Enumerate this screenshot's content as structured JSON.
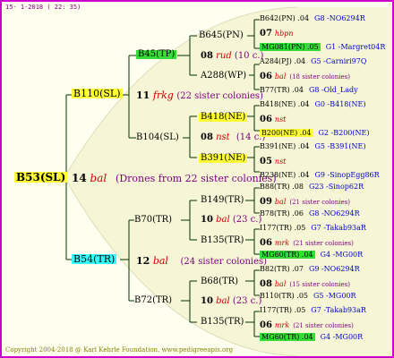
{
  "header": {
    "date": "15-  1-2018 ( 22: 35)"
  },
  "footer": {
    "text": "Copyright 2004-2018 @ Karl Kehrle Foundation.   www.pedigreeapis.org"
  },
  "queen": {
    "label": "B53(SL)"
  },
  "drones": {
    "num": "14",
    "code": "bal",
    "text": "(Drones from 22 sister colonies)"
  },
  "gen2": {
    "top": {
      "label": "B110(SL)",
      "num": "11",
      "code": "frkg",
      "text": "(22 sister colonies)"
    },
    "bottom": {
      "label": "B54(TR)",
      "num": "12",
      "code": "bal",
      "text": "(24 sister colonies)"
    }
  },
  "gen3": {
    "a": {
      "label": "B45(TP)"
    },
    "b": {
      "label": "B104(SL)",
      "num": "08",
      "code": "nst",
      "text": "(14 c.)"
    },
    "c": {
      "label": "B70(TR)",
      "num": "10",
      "code": "bal",
      "text": "(23 c.)"
    },
    "d": {
      "label": "B72(TR)",
      "num": "10",
      "code": "bal",
      "text": "(23 c.)"
    }
  },
  "gen4": {
    "a1": {
      "label": "B645(PN)",
      "num": "08",
      "code": "rud",
      "text": "(10 c.)"
    },
    "a2": {
      "label": "A288(WP)"
    },
    "b1": {
      "label": "B418(NE)"
    },
    "b2": {
      "label": "B391(NE)"
    },
    "c1": {
      "label": "B149(TR)",
      "num": "10",
      "code": "bal",
      "text": "(23 c.)"
    },
    "c2": {
      "label": "B135(TR)"
    },
    "d1": {
      "label": "B68(TR)"
    },
    "d2": {
      "label": "B135(TR)"
    }
  },
  "gen5": [
    {
      "label": "B642(PN) .04",
      "ref": "G8 -NO6294R"
    },
    {
      "num": "07",
      "code": "hbpn",
      "text": ""
    },
    {
      "label": "MG081(PN) .05",
      "ref": "G1 -Margret04R"
    },
    {
      "label": "A284(PJ) .04",
      "ref": "G5 -Carniri97Q"
    },
    {
      "num": "06",
      "code": "bal",
      "text": "(18 sister colonies)"
    },
    {
      "label": "B77(TR) .04",
      "ref": "G8 -Old_Lady"
    },
    {
      "label": "B418(NE) .04",
      "ref": "G0 -B418(NE)"
    },
    {
      "num": "06",
      "code": "nst",
      "text": ""
    },
    {
      "label": "B200(NE) .04",
      "ref": "G2 -B200(NE)"
    },
    {
      "label": "B391(NE) .04",
      "ref": "G5 -B391(NE)"
    },
    {
      "num": "05",
      "code": "nst",
      "text": ""
    },
    {
      "label": "B238(NE) .04",
      "ref": "G9 -SinopEgg86R"
    },
    {
      "label": "B88(TR) .08",
      "ref": "G23 -Sinop62R"
    },
    {
      "num": "09",
      "code": "bal",
      "text": "(21 sister colonies)"
    },
    {
      "label": "B78(TR) .06",
      "ref": "G8 -NO6294R"
    },
    {
      "label": "I177(TR) .05",
      "ref": "G7 -Takab93aR"
    },
    {
      "num": "06",
      "code": "mrk",
      "text": "(21 sister colonies)"
    },
    {
      "label": "MG60(TR) .04",
      "ref": "G4 -MG00R"
    },
    {
      "label": "B82(TR) .07",
      "ref": "G9 -NO6294R"
    },
    {
      "num": "08",
      "code": "bal",
      "text": "(15 sister colonies)"
    },
    {
      "label": "B110(TR) .05",
      "ref": "G5 -MG00R"
    },
    {
      "label": "I177(TR) .05",
      "ref": "G7 -Takab93aR"
    },
    {
      "num": "06",
      "code": "mrk",
      "text": "(21 sister colonies)"
    },
    {
      "label": "MG60(TR) .04",
      "ref": "G4 -MG00R"
    }
  ]
}
